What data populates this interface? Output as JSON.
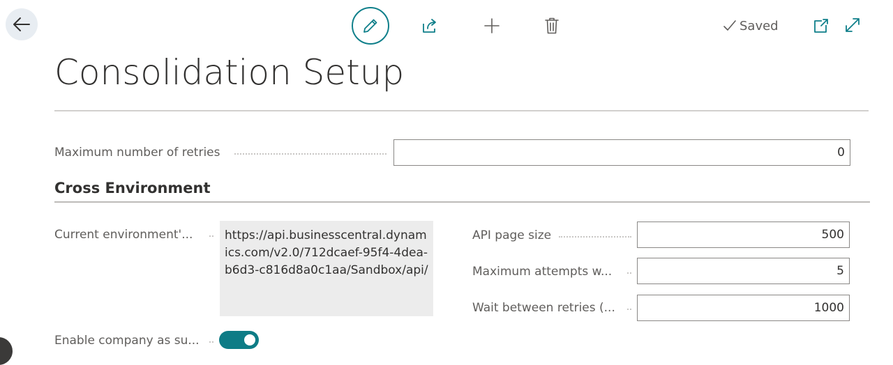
{
  "toolbar": {
    "saved_label": "Saved"
  },
  "page": {
    "title": "Consolidation Setup"
  },
  "fields": {
    "max_retries": {
      "label": "Maximum number of retries",
      "value": "0"
    }
  },
  "cross_environment": {
    "heading": "Cross Environment",
    "current_env": {
      "label": "Current environment'...",
      "value": "https://api.businesscentral.dynamics.com/v2.0/712dcaef-95f4-4dea-b6d3-c816d8a0c1aa/Sandbox/api/"
    },
    "api_page_size": {
      "label": "API page size",
      "value": "500"
    },
    "max_attempts": {
      "label": "Maximum attempts w...",
      "value": "5"
    },
    "wait_between": {
      "label": "Wait between retries (...",
      "value": "1000"
    },
    "enable_company": {
      "label": "Enable company as su...",
      "enabled": true
    }
  },
  "colors": {
    "accent": "#0e7c86",
    "text": "#323130",
    "muted": "#605e5c"
  }
}
